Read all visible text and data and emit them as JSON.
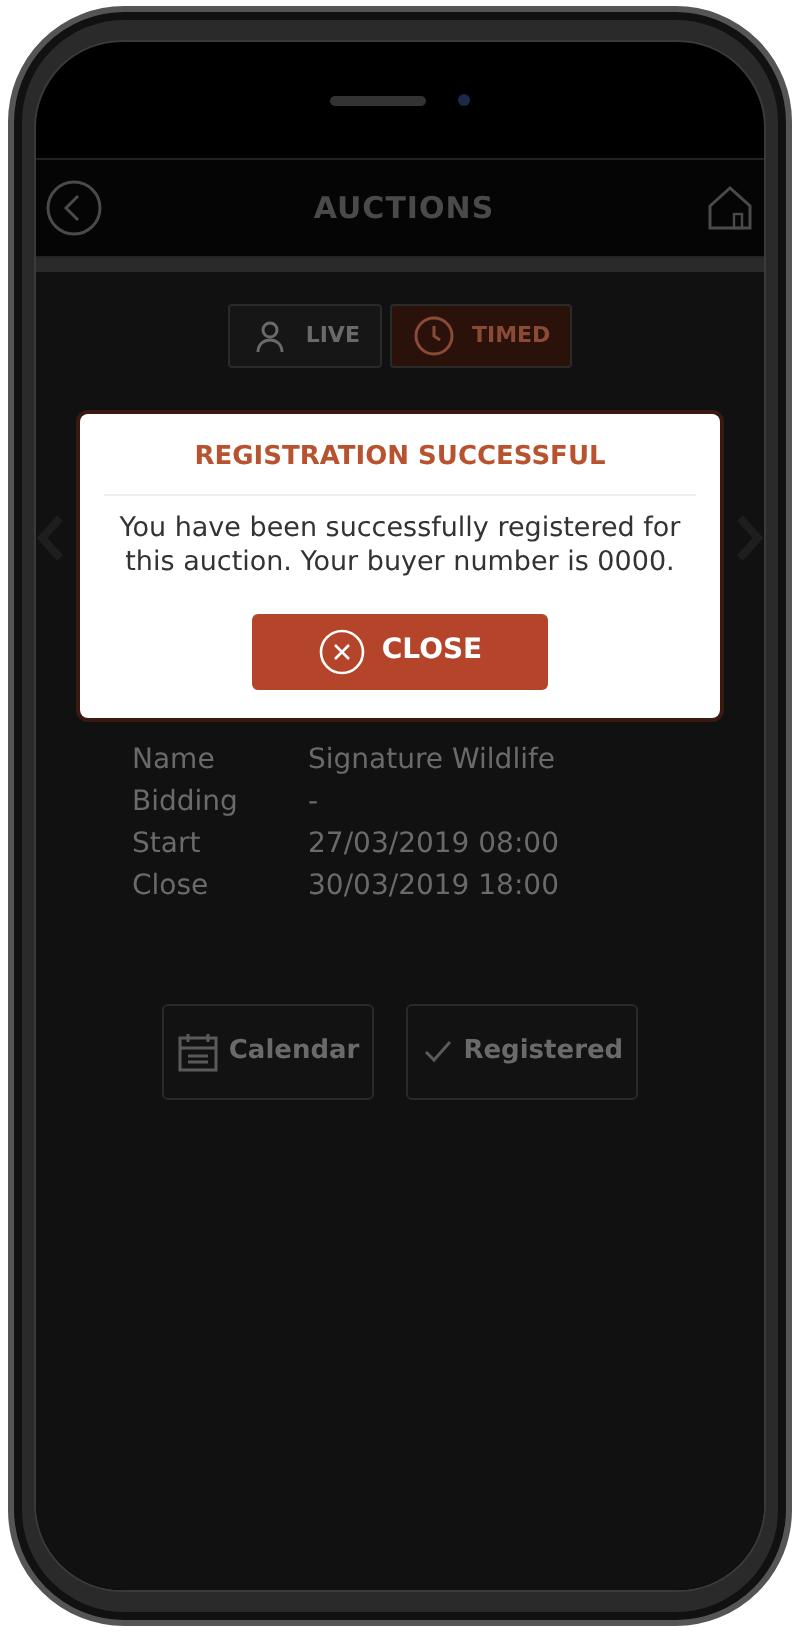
{
  "header": {
    "title": "AUCTIONS"
  },
  "tabs": [
    {
      "label": "LIVE",
      "kind": "live",
      "selected": false
    },
    {
      "label": "TIMED",
      "kind": "timed",
      "selected": true
    }
  ],
  "details": [
    {
      "label": "Name",
      "value": "Signature Wildlife"
    },
    {
      "label": "Bidding",
      "value": "-"
    },
    {
      "label": "Start",
      "value": "27/03/2019 08:00"
    },
    {
      "label": "Close",
      "value": "30/03/2019 18:00"
    }
  ],
  "actions": [
    {
      "label": "Calendar",
      "kind": "calendar"
    },
    {
      "label": "Registered",
      "kind": "registered"
    }
  ],
  "dialog": {
    "title": "REGISTRATION SUCCESSFUL",
    "message": "You have been successfully registered for this auction. Your buyer number is 0000.",
    "button": "CLOSE"
  }
}
